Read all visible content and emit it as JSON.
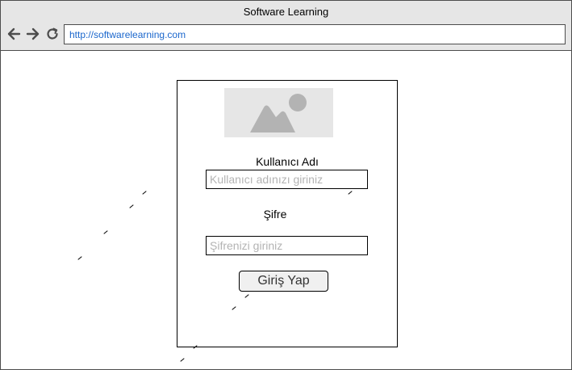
{
  "browser": {
    "title": "Software Learning",
    "url": "http://softwarelearning.com",
    "icons": [
      "back-arrow-icon",
      "forward-arrow-icon",
      "reload-icon"
    ]
  },
  "login": {
    "username_label": "Kullanıcı Adı",
    "username_placeholder": "Kullanıcı adınızı giriniz",
    "password_label": "Şifre",
    "password_placeholder": "Şifrenizi giriniz",
    "submit_label": "Giriş Yap",
    "image_icon": "image-placeholder-icon"
  },
  "colors": {
    "chrome": "#e6e6e6",
    "url_text": "#1a66cc",
    "placeholder_text": "#b3b3b3",
    "image_glyph": "#b3b3b3"
  }
}
